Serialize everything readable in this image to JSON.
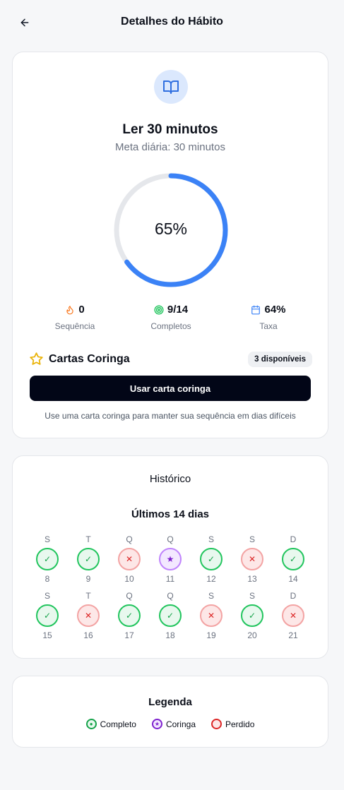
{
  "header": {
    "title": "Detalhes do Hábito"
  },
  "habit": {
    "title": "Ler 30 minutos",
    "goal": "Meta diária: 30 minutos",
    "progress_percent": 65,
    "progress_label": "65%",
    "icon": "book-open-icon"
  },
  "stats": [
    {
      "value": "0",
      "label": "Sequência",
      "icon": "flame-icon",
      "color": "#f97316"
    },
    {
      "value": "9/14",
      "label": "Completos",
      "icon": "target-icon",
      "color": "#22c55e"
    },
    {
      "value": "64%",
      "label": "Taxa",
      "icon": "calendar-icon",
      "color": "#3b82f6"
    }
  ],
  "jokers": {
    "title": "Cartas Coringa",
    "badge": "3 disponíveis",
    "button": "Usar carta coringa",
    "hint": "Use uma carta coringa para manter sua sequência em dias difíceis"
  },
  "history": {
    "title": "Histórico",
    "subtitle": "Últimos 14 dias",
    "days": [
      {
        "letter": "S",
        "num": "8",
        "status": "done",
        "symbol": "✓"
      },
      {
        "letter": "T",
        "num": "9",
        "status": "done",
        "symbol": "✓"
      },
      {
        "letter": "Q",
        "num": "10",
        "status": "lost",
        "symbol": "✕"
      },
      {
        "letter": "Q",
        "num": "11",
        "status": "joker",
        "symbol": "★"
      },
      {
        "letter": "S",
        "num": "12",
        "status": "done",
        "symbol": "✓"
      },
      {
        "letter": "S",
        "num": "13",
        "status": "lost",
        "symbol": "✕"
      },
      {
        "letter": "D",
        "num": "14",
        "status": "done",
        "symbol": "✓"
      },
      {
        "letter": "S",
        "num": "15",
        "status": "done",
        "symbol": "✓"
      },
      {
        "letter": "T",
        "num": "16",
        "status": "lost",
        "symbol": "✕"
      },
      {
        "letter": "Q",
        "num": "17",
        "status": "done",
        "symbol": "✓"
      },
      {
        "letter": "Q",
        "num": "18",
        "status": "done",
        "symbol": "✓"
      },
      {
        "letter": "S",
        "num": "19",
        "status": "lost",
        "symbol": "✕"
      },
      {
        "letter": "S",
        "num": "20",
        "status": "done",
        "symbol": "✓"
      },
      {
        "letter": "D",
        "num": "21",
        "status": "lost",
        "symbol": "✕"
      }
    ]
  },
  "legend": {
    "title": "Legenda",
    "items": [
      {
        "label": "Completo",
        "status": "done",
        "symbol": "●"
      },
      {
        "label": "Coringa",
        "status": "joker",
        "symbol": "★"
      },
      {
        "label": "Perdido",
        "status": "lost",
        "symbol": ""
      }
    ]
  },
  "colors": {
    "accent": "#3b82f6",
    "ring_track": "#e5e7eb",
    "done": "#22c55e",
    "lost": "#f3a3a3",
    "joker": "#c084fc",
    "star": "#eab308"
  }
}
